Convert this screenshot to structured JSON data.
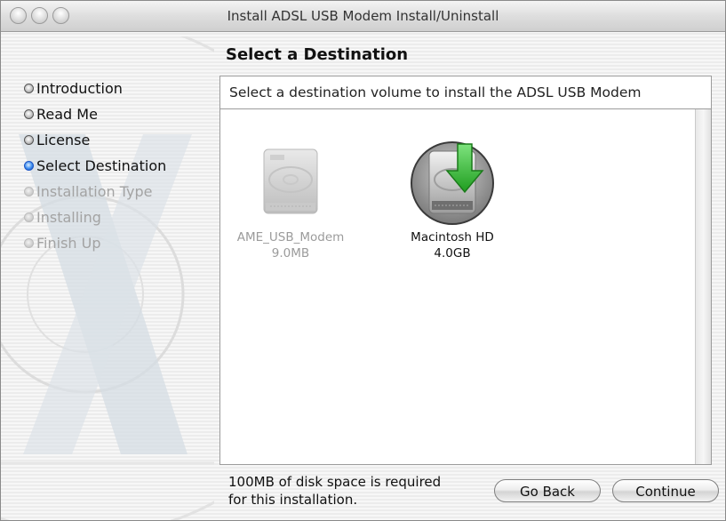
{
  "window": {
    "title": "Install ADSL USB Modem Install/Uninstall"
  },
  "sidebar": {
    "steps": [
      {
        "label": "Introduction",
        "state": "done"
      },
      {
        "label": "Read Me",
        "state": "done"
      },
      {
        "label": "License",
        "state": "done"
      },
      {
        "label": "Select Destination",
        "state": "current"
      },
      {
        "label": "Installation Type",
        "state": "future"
      },
      {
        "label": "Installing",
        "state": "future"
      },
      {
        "label": "Finish Up",
        "state": "future"
      }
    ]
  },
  "main": {
    "heading": "Select a Destination",
    "description": "Select a destination volume to install the ADSL USB Modem",
    "volumes": [
      {
        "name": "AME_USB_Modem",
        "size": "9.0MB",
        "icon": "hard-disk-icon",
        "enabled": false
      },
      {
        "name": "Macintosh HD",
        "size": "4.0GB",
        "icon": "hard-disk-install-arrow-icon",
        "enabled": true,
        "selected": true
      }
    ]
  },
  "footer": {
    "requirement_line1": "100MB of disk space is required",
    "requirement_line2": "for this installation."
  },
  "buttons": {
    "go_back": "Go Back",
    "continue": "Continue"
  },
  "colors": {
    "current_step": "#2a6fe0",
    "install_arrow": "#3cc43c"
  }
}
